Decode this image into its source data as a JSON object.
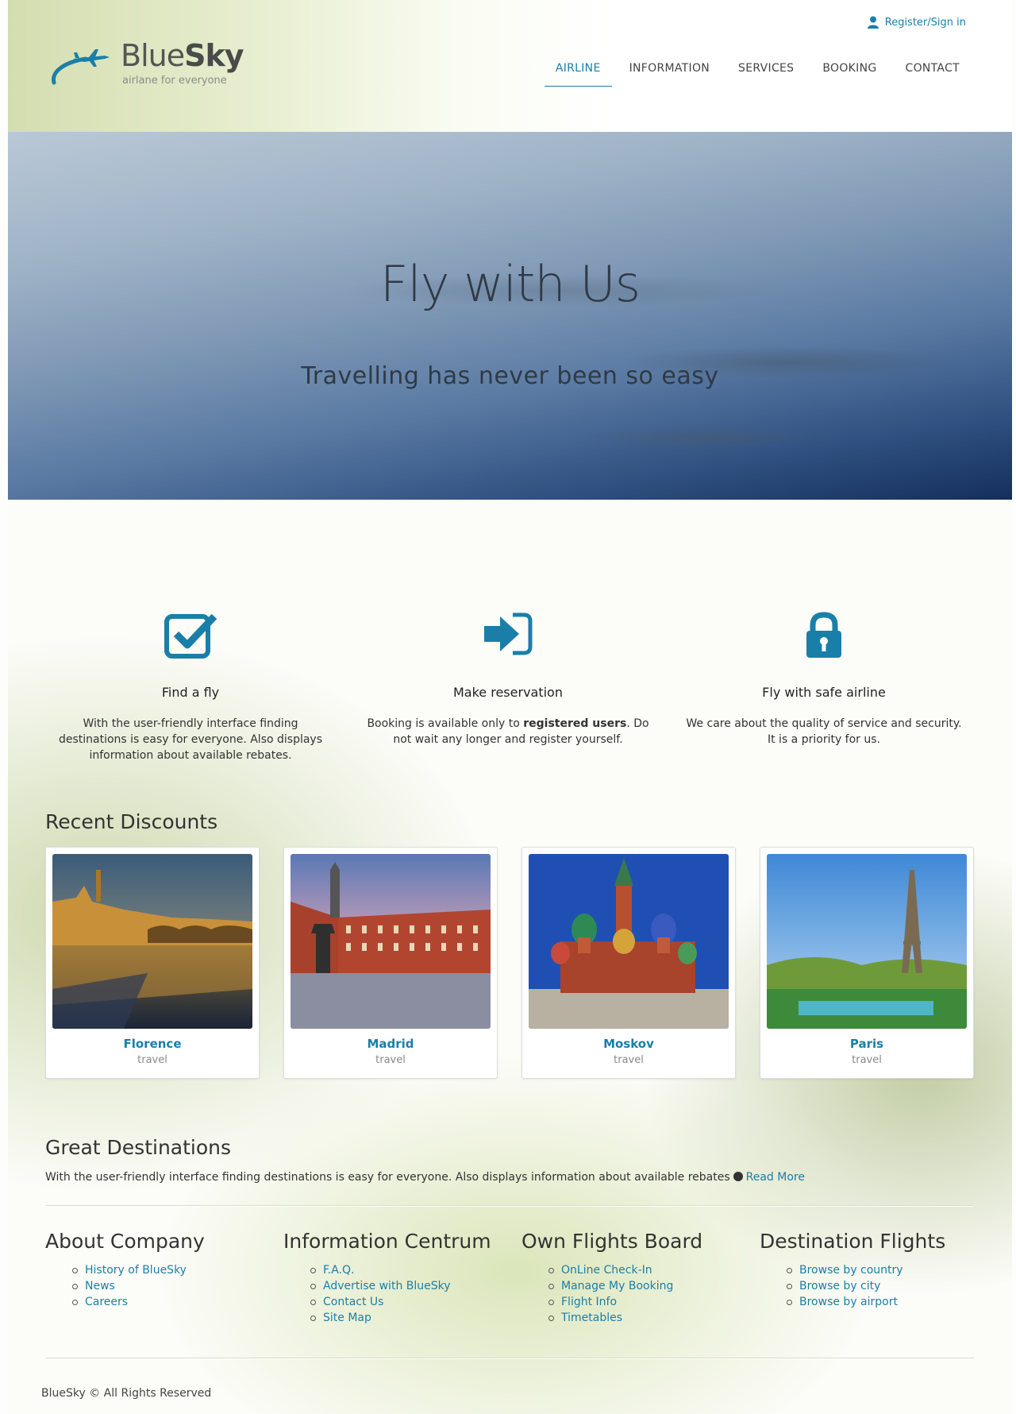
{
  "header": {
    "logo_word1": "Blue",
    "logo_word2": "Sky",
    "tagline": "airlane for everyone",
    "register": "Register/Sign in",
    "nav": [
      "AIRLINE",
      "INFORMATION",
      "SERVICES",
      "BOOKING",
      "CONTACT"
    ],
    "active_nav": "AIRLINE"
  },
  "hero": {
    "title": "Fly with Us",
    "subtitle": "Travelling has never been so easy"
  },
  "features": [
    {
      "icon": "checkbox-icon",
      "title": "Find a fly",
      "text": "With the user-friendly interface finding destinations is easy for everyone. Also displays information about available rebates."
    },
    {
      "icon": "sign-in-icon",
      "title": "Make reservation",
      "text_before": "Booking is available only to ",
      "text_bold": "registered users",
      "text_after": ". Do not wait any longer and register yourself."
    },
    {
      "icon": "lock-icon",
      "title": "Fly with safe airline",
      "text": "We care about the quality of service and security. It is a priority for us."
    }
  ],
  "discounts": {
    "title": "Recent Discounts",
    "cards": [
      {
        "name": "Florence",
        "sub": "travel"
      },
      {
        "name": "Madrid",
        "sub": "travel"
      },
      {
        "name": "Moskov",
        "sub": "travel"
      },
      {
        "name": "Paris",
        "sub": "travel"
      }
    ]
  },
  "great": {
    "title": "Great Destinations",
    "text": "With the user-friendly interface finding destinations is easy for everyone. Also displays information about available rebates",
    "read_more": "Read More"
  },
  "columns": [
    {
      "title": "About Company",
      "links": [
        "History of BlueSky",
        "News",
        "Careers"
      ]
    },
    {
      "title": "Information Centrum",
      "links": [
        "F.A.Q.",
        "Advertise with BlueSky",
        "Contact Us",
        "Site Map"
      ]
    },
    {
      "title": "Own Flights Board",
      "links": [
        "OnLine Check-In",
        "Manage My Booking",
        "Flight Info",
        "Timetables"
      ]
    },
    {
      "title": "Destination Flights",
      "links": [
        "Browse by country",
        "Browse by city",
        "Browse by airport"
      ]
    }
  ],
  "footer": "BlueSky © All Rights Reserved",
  "colors": {
    "accent": "#1a7fa8",
    "text": "#333333"
  }
}
